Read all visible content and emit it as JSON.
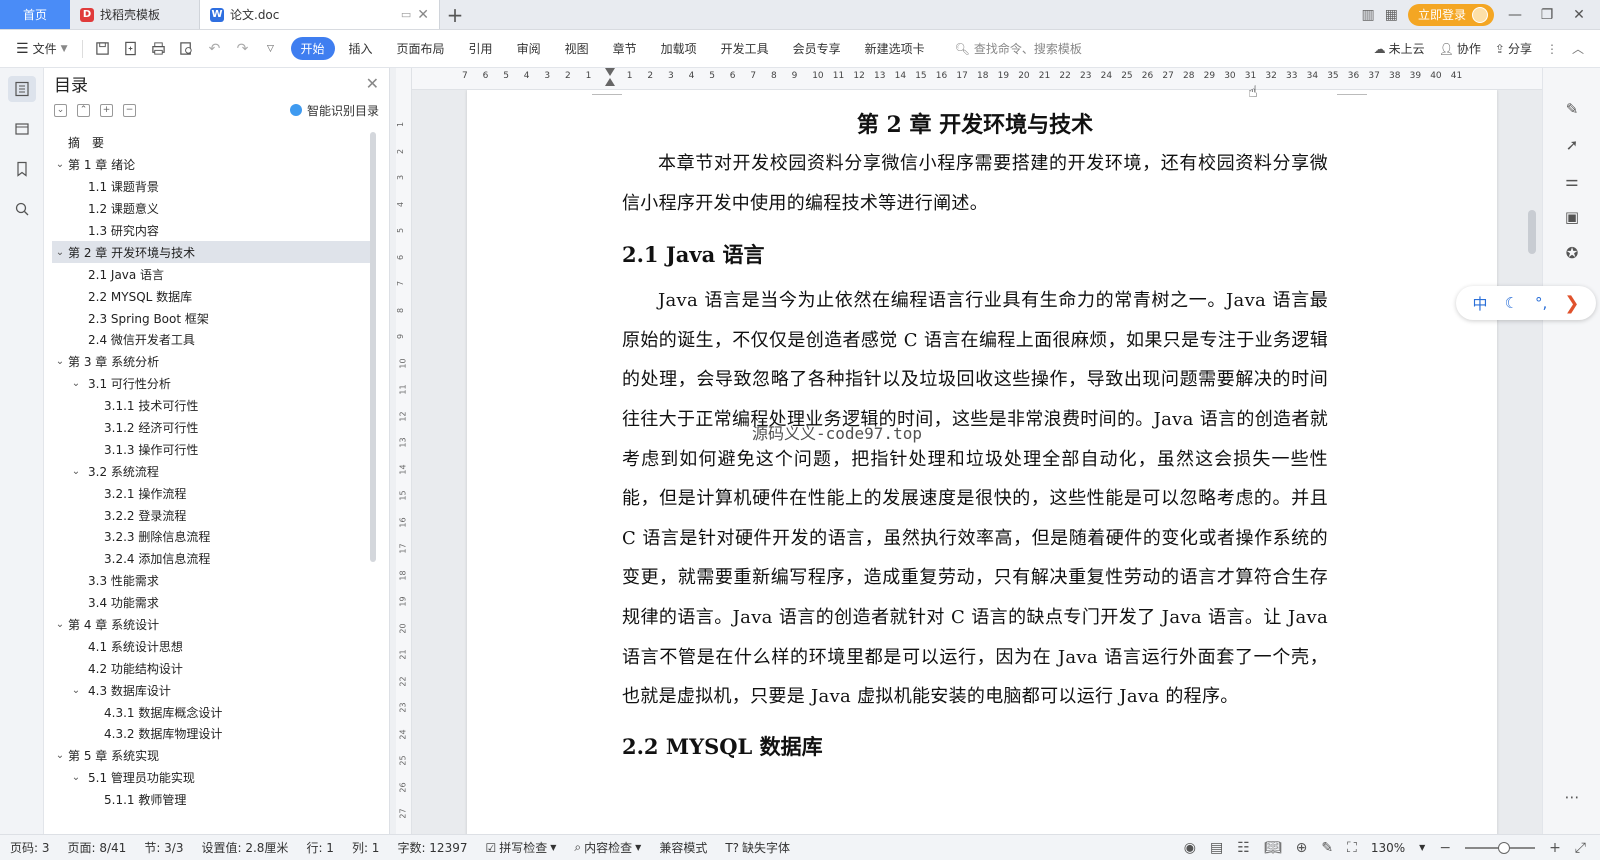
{
  "tabs": {
    "home": "首页",
    "templates": "找稻壳模板",
    "document": "论文.doc"
  },
  "window": {
    "login": "立即登录"
  },
  "toolbar": {
    "file": "文件",
    "menus": [
      "开始",
      "插入",
      "页面布局",
      "引用",
      "审阅",
      "视图",
      "章节",
      "加载项",
      "开发工具",
      "会员专享",
      "新建选项卡"
    ],
    "active_menu": "开始",
    "search_placeholder": "查找命令、搜索模板",
    "cloud": "未上云",
    "collab": "协作",
    "share": "分享"
  },
  "toc": {
    "title": "目录",
    "smart": "智能识别目录",
    "items": [
      {
        "label": "摘　要",
        "level": 0,
        "chev": ""
      },
      {
        "label": "第 1 章  绪论",
        "level": 0,
        "chev": "v"
      },
      {
        "label": "1.1  课题背景",
        "level": 1,
        "chev": ""
      },
      {
        "label": "1.2  课题意义",
        "level": 1,
        "chev": ""
      },
      {
        "label": "1.3  研究内容",
        "level": 1,
        "chev": ""
      },
      {
        "label": "第 2 章  开发环境与技术",
        "level": 0,
        "chev": "v",
        "selected": true
      },
      {
        "label": "2.1 Java 语言",
        "level": 1,
        "chev": ""
      },
      {
        "label": "2.2 MYSQL 数据库",
        "level": 1,
        "chev": ""
      },
      {
        "label": "2.3 Spring Boot 框架",
        "level": 1,
        "chev": ""
      },
      {
        "label": "2.4 微信开发者工具",
        "level": 1,
        "chev": ""
      },
      {
        "label": "第 3 章  系统分析",
        "level": 0,
        "chev": "v"
      },
      {
        "label": "3.1  可行性分析",
        "level": 1,
        "chev": "v"
      },
      {
        "label": "3.1.1  技术可行性",
        "level": 2,
        "chev": ""
      },
      {
        "label": "3.1.2  经济可行性",
        "level": 2,
        "chev": ""
      },
      {
        "label": "3.1.3  操作可行性",
        "level": 2,
        "chev": ""
      },
      {
        "label": "3.2  系统流程",
        "level": 1,
        "chev": "v"
      },
      {
        "label": "3.2.1  操作流程",
        "level": 2,
        "chev": ""
      },
      {
        "label": "3.2.2  登录流程",
        "level": 2,
        "chev": ""
      },
      {
        "label": "3.2.3  删除信息流程",
        "level": 2,
        "chev": ""
      },
      {
        "label": "3.2.4  添加信息流程",
        "level": 2,
        "chev": ""
      },
      {
        "label": "3.3  性能需求",
        "level": 1,
        "chev": ""
      },
      {
        "label": "3.4  功能需求",
        "level": 1,
        "chev": ""
      },
      {
        "label": "第 4 章  系统设计",
        "level": 0,
        "chev": "v"
      },
      {
        "label": "4.1  系统设计思想",
        "level": 1,
        "chev": ""
      },
      {
        "label": "4.2  功能结构设计",
        "level": 1,
        "chev": ""
      },
      {
        "label": "4.3  数据库设计",
        "level": 1,
        "chev": "v"
      },
      {
        "label": "4.3.1  数据库概念设计",
        "level": 2,
        "chev": ""
      },
      {
        "label": "4.3.2  数据库物理设计",
        "level": 2,
        "chev": ""
      },
      {
        "label": "第 5 章  系统实现",
        "level": 0,
        "chev": "v"
      },
      {
        "label": "5.1  管理员功能实现",
        "level": 1,
        "chev": "v"
      },
      {
        "label": "5.1.1  教师管理",
        "level": 2,
        "chev": ""
      }
    ]
  },
  "ruler": {
    "h_ticks": [
      "7",
      "6",
      "5",
      "4",
      "3",
      "2",
      "1",
      "",
      "1",
      "2",
      "3",
      "4",
      "5",
      "6",
      "7",
      "8",
      "9",
      "10",
      "11",
      "12",
      "13",
      "14",
      "15",
      "16",
      "17",
      "18",
      "19",
      "20",
      "21",
      "22",
      "23",
      "24",
      "25",
      "26",
      "27",
      "28",
      "29",
      "30",
      "31",
      "32",
      "33",
      "34",
      "35",
      "36",
      "37",
      "38",
      "39",
      "40",
      "41"
    ],
    "v_ticks": [
      "1",
      "2",
      "3",
      "4",
      "5",
      "6",
      "7",
      "8",
      "9",
      "10",
      "11",
      "12",
      "13",
      "14",
      "15",
      "16",
      "17",
      "18",
      "19",
      "20",
      "21",
      "22",
      "23",
      "24",
      "25",
      "26",
      "27"
    ]
  },
  "document": {
    "chapter_title": "第 2 章  开发环境与技术",
    "intro": "本章节对开发校园资料分享微信小程序需要搭建的开发环境，还有校园资料分享微信小程序开发中使用的编程技术等进行阐述。",
    "section1_title": "2.1 Java 语言",
    "section1_body": "Java 语言是当今为止依然在编程语言行业具有生命力的常青树之一。Java 语言最原始的诞生，不仅仅是创造者感觉 C 语言在编程上面很麻烦，如果只是专注于业务逻辑的处理，会导致忽略了各种指针以及垃圾回收这些操作，导致出现问题需要解决的时间往往大于正常编程处理业务逻辑的时间，这些是非常浪费时间的。Java 语言的创造者就考虑到如何避免这个问题，把指针处理和垃圾处理全部自动化，虽然这会损失一些性能，但是计算机硬件在性能上的发展速度是很快的，这些性能是可以忽略考虑的。并且 C 语言是针对硬件开发的语言，虽然执行效率高，但是随着硬件的变化或者操作系统的变更，就需要重新编写程序，造成重复劳动，只有解决重复性劳动的语言才算符合生存规律的语言。Java 语言的创造者就针对 C 语言的缺点专门开发了 Java 语言。让 Java 语言不管是在什么样的环境里都是可以运行，因为在 Java 语言运行外面套了一个壳，也就是虚拟机，只要是 Java 虚拟机能安装的电脑都可以运行 Java 的程序。",
    "section2_title": "2.2 MYSQL 数据库",
    "watermark": "源码义义-code97.top"
  },
  "ime": {
    "lang": "中"
  },
  "status": {
    "page_code": "页码: 3",
    "page": "页面: 8/41",
    "section": "节: 3/3",
    "setting": "设置值: 2.8厘米",
    "row": "行: 1",
    "col": "列: 1",
    "words": "字数: 12397",
    "spell": "拼写检查",
    "content_check": "内容检查",
    "compat": "兼容模式",
    "missing_font": "缺失字体",
    "zoom": "130%",
    "zoom_level": 0.55
  },
  "colors": {
    "accent": "#3f7ef0",
    "home_tab": "#4a8cf7",
    "login": "#f4a623"
  }
}
